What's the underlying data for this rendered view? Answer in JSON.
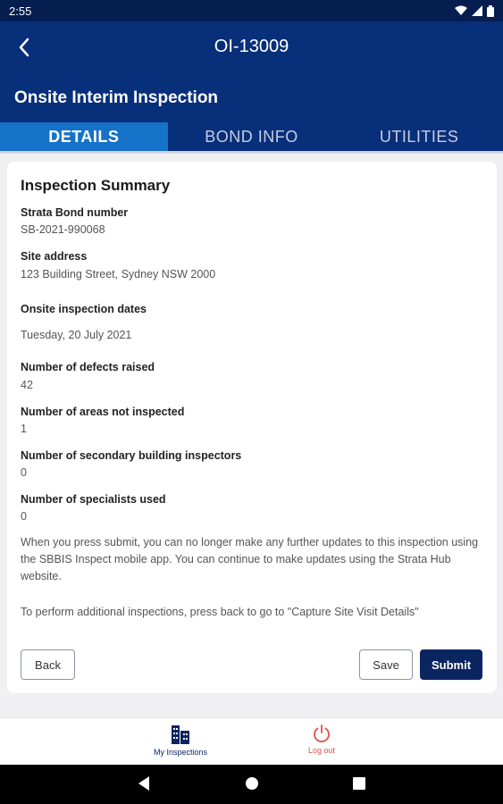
{
  "status_bar": {
    "time": "2:55"
  },
  "app_bar": {
    "title": "OI-13009"
  },
  "page": {
    "heading": "Onsite Interim Inspection"
  },
  "tabs": [
    {
      "label": "DETAILS",
      "active": true
    },
    {
      "label": "BOND INFO",
      "active": false
    },
    {
      "label": "UTILITIES",
      "active": false
    }
  ],
  "summary": {
    "title": "Inspection Summary",
    "fields": [
      {
        "label": "Strata Bond number",
        "value": "SB-2021-990068"
      },
      {
        "label": "Site address",
        "value": "123 Building Street, Sydney NSW 2000"
      },
      {
        "label": "Onsite inspection dates",
        "value": "Tuesday, 20 July 2021"
      },
      {
        "label": "Number of defects raised",
        "value": "42"
      },
      {
        "label": "Number of areas not inspected",
        "value": "1"
      },
      {
        "label": "Number of secondary building inspectors",
        "value": "0"
      },
      {
        "label": "Number of specialists used",
        "value": "0"
      }
    ],
    "submit_note": "When you press submit, you can no longer make any further updates to this inspection using the SBBIS Inspect mobile app. You can continue to make updates using the Strata Hub website.",
    "additional_note": "To perform additional inspections, press back to go to \"Capture Site Visit Details\""
  },
  "actions": {
    "back": "Back",
    "save": "Save",
    "submit": "Submit"
  },
  "bottom_nav": {
    "items": [
      {
        "label": "My Inspections",
        "icon": "buildings-icon",
        "color": "#0b2561"
      },
      {
        "label": "Log out",
        "icon": "power-icon",
        "color": "#e05050"
      }
    ]
  },
  "colors": {
    "primary": "#082f7a",
    "tab_active": "#1572c9",
    "button": "#0b2561",
    "logout": "#e05050"
  }
}
